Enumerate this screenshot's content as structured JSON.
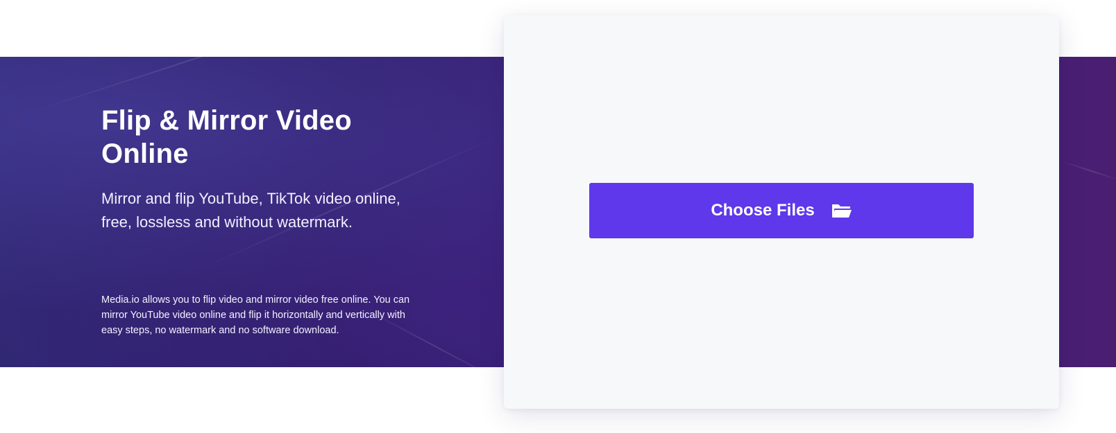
{
  "hero": {
    "title": "Flip & Mirror Video Online",
    "subtitle": "Mirror and flip YouTube, TikTok video online, free, lossless and without watermark.",
    "description": "Media.io allows you to flip video and mirror video free online. You can mirror YouTube video online and flip it horizontally and vertically with easy steps, no watermark and no software download."
  },
  "upload": {
    "button_label": "Choose Files",
    "button_icon": "folder-open-icon"
  },
  "colors": {
    "hero_band": "#2d1c66",
    "accent_button": "#5e38ea",
    "card_background": "#f7f8fa"
  }
}
